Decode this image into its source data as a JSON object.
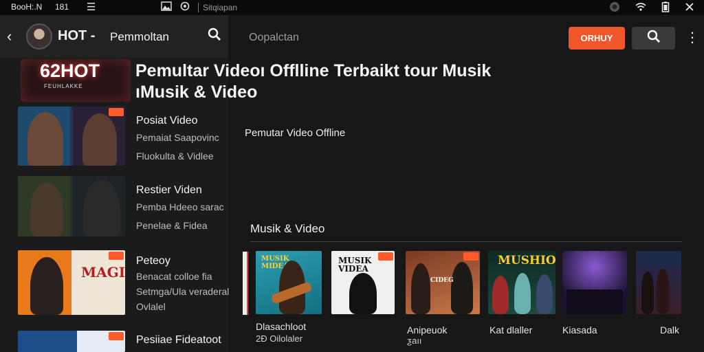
{
  "status_bar": {
    "clock": "BooH:.N",
    "number": "181",
    "menu_glyph": "☰",
    "app_label": "Sitqiapan",
    "icons": [
      "image-icon",
      "settings-circle-icon",
      "record-icon",
      "wifi-icon",
      "battery-icon",
      "close-icon"
    ]
  },
  "app_bar": {
    "back_glyph": "‹",
    "title": "HOT -",
    "tab": "Pemmoltan",
    "search_glyph": "⌕",
    "right_tab": "Oopalctan",
    "orange_button": "ORHUY",
    "more_glyph": "⋮"
  },
  "logo": {
    "main": "62HOT",
    "sub": "FEUHLAKKE"
  },
  "headline": {
    "line1": "Pemultar Videoı Offlline Terbaikt tour Musik",
    "line2": "ıMusik & Video"
  },
  "list": [
    {
      "title": "Posiat Video",
      "lines": [
        "Pemaiat Saapovinc",
        "Fluokulta & Vidlee"
      ]
    },
    {
      "title": "Restier Viden",
      "lines": [
        "Pemba Hdeeo sarac",
        "Penelae & Fidea"
      ]
    },
    {
      "title": "Peteoy",
      "lines": [
        "Benacat colloe fia",
        "Setmga/Ula veraderal",
        "Ovlalel"
      ]
    },
    {
      "title": "Pesiiae Fideatoot",
      "lines": []
    }
  ],
  "section_offline": "Pemutar Video Offline",
  "section_music": "Musik & Video",
  "cards": [
    {
      "label": "Dlasachloot",
      "label2": "2Ɖ Oilolaler",
      "art_text": "MUSIK\nMIDEA"
    },
    {
      "label": "",
      "label2": "",
      "art_text": "MUSIK\nVIDEA"
    },
    {
      "label": "Anipeuok",
      "label2": "ƺaıı",
      "art_text": "CIDEG"
    },
    {
      "label": "Kat dlaller",
      "label2": "",
      "art_text": "MUSHIO"
    },
    {
      "label": "Kiasada",
      "label2": "",
      "art_text": ""
    },
    {
      "label": "Dalk",
      "label2": "",
      "art_text": ""
    }
  ],
  "colors": {
    "accent": "#f0562a",
    "background": "#141414",
    "panel_left": "#1b1b1b",
    "panel_right": "#171717"
  }
}
